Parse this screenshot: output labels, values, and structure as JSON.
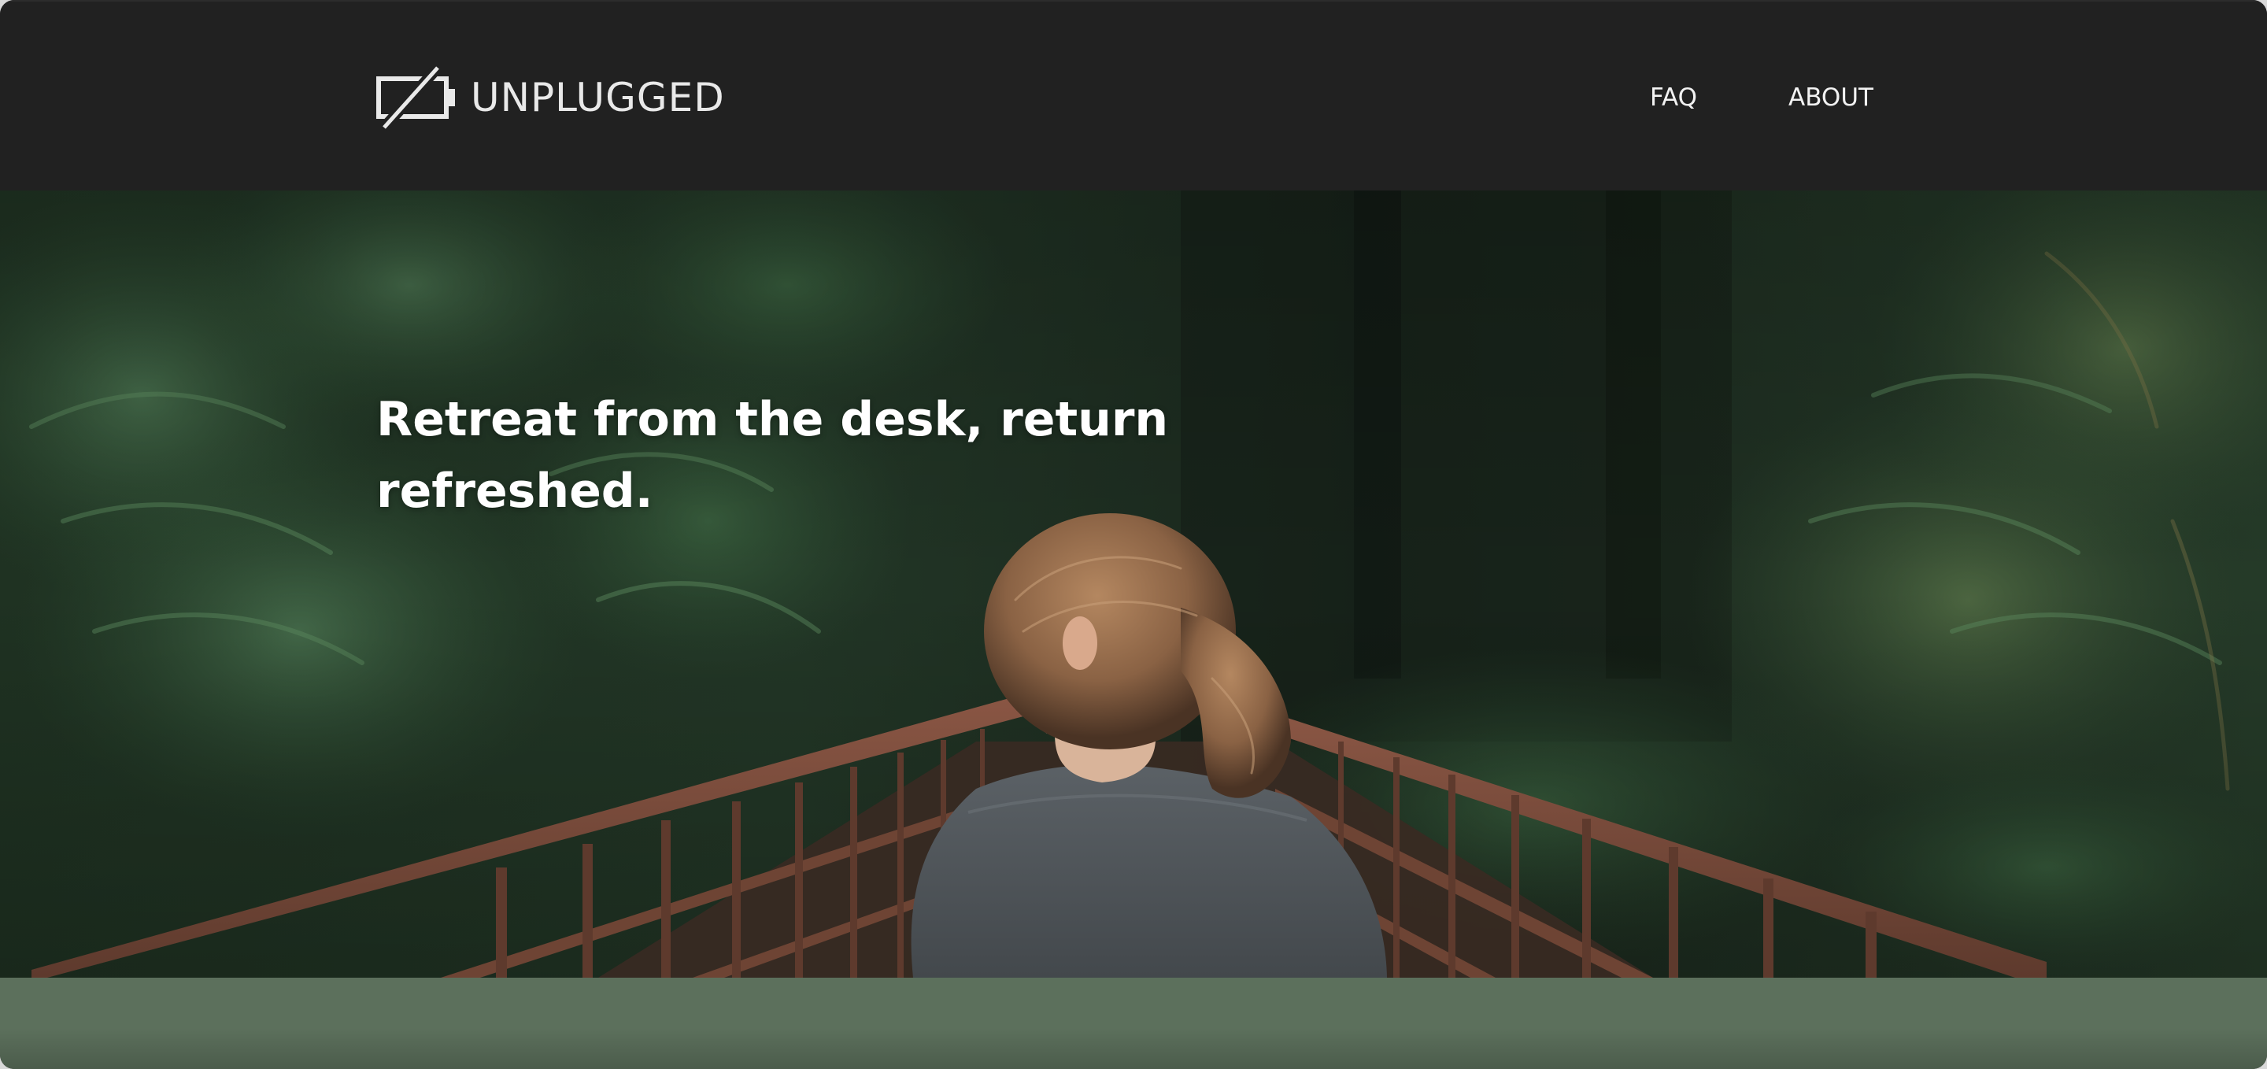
{
  "brand": {
    "name": "UNPLUGGED",
    "icon": "battery-slash-icon"
  },
  "nav": {
    "items": [
      {
        "label": "FAQ"
      },
      {
        "label": "ABOUT"
      }
    ]
  },
  "hero": {
    "headline": "Retreat from the desk, return refreshed.",
    "image": "woman-on-forest-bridge"
  },
  "colors": {
    "header_bg": "#212121",
    "text_light": "#f2f2f2",
    "strip_green": "#5c705c",
    "forest_dark": "#1e2a1f",
    "bridge_rust": "#7a4a3a",
    "shirt_gray": "#54595d",
    "hair_brown": "#8a6244"
  }
}
